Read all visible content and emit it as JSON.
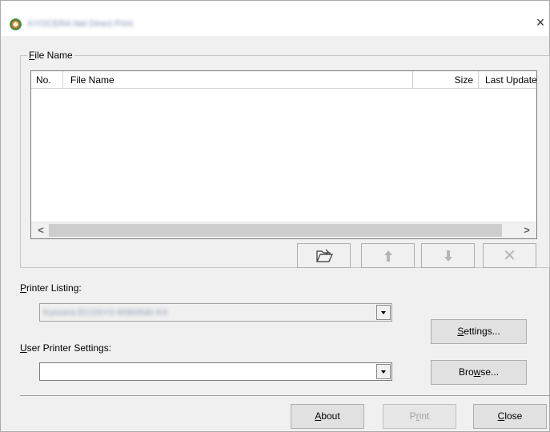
{
  "window": {
    "title": "KYOCERA Net Direct Print",
    "close_glyph": "×",
    "icon": "app-icon"
  },
  "file_group": {
    "label_mnemonic": "F",
    "label_rest": "ile Name"
  },
  "file_list": {
    "columns": [
      "No.",
      "File Name",
      "Size",
      "Last Update"
    ],
    "rows": []
  },
  "scrollbar": {
    "left_glyph": "<",
    "right_glyph": ">"
  },
  "toolbar": {
    "open_icon": "📂",
    "up_icon": "🡑",
    "down_icon": "🡓",
    "delete_icon": "✕"
  },
  "printer_listing": {
    "label_mnemonic": "P",
    "label_rest": "rinter Listing:",
    "value": "Kyocera ECOSYS M3645dn KX"
  },
  "user_printer_settings": {
    "label_mnemonic": "U",
    "label_rest": "ser Printer Settings:",
    "value": ""
  },
  "buttons": {
    "settings": {
      "mnemonic": "S",
      "rest": "ettings..."
    },
    "browse": {
      "pre": "Bro",
      "mnemonic": "w",
      "rest": "se..."
    },
    "about": {
      "mnemonic": "A",
      "rest": "bout"
    },
    "print": {
      "pre": "P",
      "mnemonic": "r",
      "rest": "int"
    },
    "close": {
      "mnemonic": "C",
      "rest": "lose"
    }
  }
}
